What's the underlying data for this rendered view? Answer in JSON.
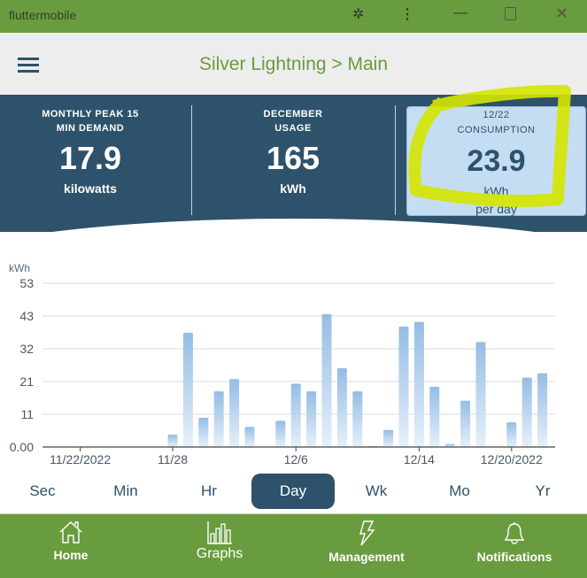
{
  "window": {
    "title": "fluttermobile",
    "icons": [
      "puzzle-icon",
      "more-vert-icon",
      "minimize-icon",
      "maximize-icon",
      "close-icon"
    ]
  },
  "appbar": {
    "title": "Silver Lightning > Main",
    "menu_icon": "hamburger-icon"
  },
  "stats": [
    {
      "label_line1": "MONTHLY PEAK 15",
      "label_line2": "MIN DEMAND",
      "value": "17.9",
      "unit": "kilowatts"
    },
    {
      "label_line1": "DECEMBER",
      "label_line2": "USAGE",
      "value": "165",
      "unit": "kWh"
    },
    {
      "label_line1": "12/22",
      "label_line2": "CONSUMPTION",
      "value": "23.9",
      "unit": "kWh",
      "unit2": "per day",
      "highlighted": true
    }
  ],
  "colors": {
    "brand_green": "#699c3e",
    "navy": "#2e526b",
    "card_highlight": "#c5ddf2",
    "bar": "#9bc2e6",
    "annotation": "#d4e600"
  },
  "chart_data": {
    "type": "bar",
    "ylabel": "kWh",
    "ylim": [
      0,
      53
    ],
    "yticks": [
      "0.00",
      "11",
      "21",
      "32",
      "43",
      "53"
    ],
    "ytick_values": [
      0,
      10.6,
      21.2,
      31.8,
      42.4,
      53
    ],
    "xtick_labels": [
      {
        "label": "11/22/2022",
        "day": "11/22"
      },
      {
        "label": "11/28",
        "day": "11/28"
      },
      {
        "label": "12/6",
        "day": "12/6"
      },
      {
        "label": "12/14",
        "day": "12/14"
      },
      {
        "label": "12/20/2022",
        "day": "12/20"
      }
    ],
    "categories": [
      "11/22",
      "11/23",
      "11/24",
      "11/25",
      "11/26",
      "11/27",
      "11/28",
      "11/29",
      "11/30",
      "12/1",
      "12/2",
      "12/3",
      "12/4",
      "12/5",
      "12/6",
      "12/7",
      "12/8",
      "12/9",
      "12/10",
      "12/11",
      "12/12",
      "12/13",
      "12/14",
      "12/15",
      "12/16",
      "12/17",
      "12/18",
      "12/19",
      "12/20",
      "12/21",
      "12/22"
    ],
    "values": [
      0,
      0,
      0,
      0,
      0,
      0,
      4,
      37,
      9.5,
      18,
      22,
      6.5,
      0,
      8.5,
      20.5,
      18,
      43,
      25.5,
      18,
      0.3,
      5.5,
      39,
      40.5,
      19.5,
      1,
      15,
      34,
      0,
      8,
      22.5,
      23.9
    ],
    "grid": true
  },
  "tabs": [
    {
      "label": "Sec"
    },
    {
      "label": "Min"
    },
    {
      "label": "Hr"
    },
    {
      "label": "Day",
      "active": true
    },
    {
      "label": "Wk"
    },
    {
      "label": "Mo"
    },
    {
      "label": "Yr"
    }
  ],
  "nav": [
    {
      "label": "Home",
      "icon": "home-icon"
    },
    {
      "label": "Graphs",
      "icon": "bar-chart-icon",
      "active": true
    },
    {
      "label": "Management",
      "icon": "lightning-icon"
    },
    {
      "label": "Notifications",
      "icon": "bell-icon"
    }
  ]
}
